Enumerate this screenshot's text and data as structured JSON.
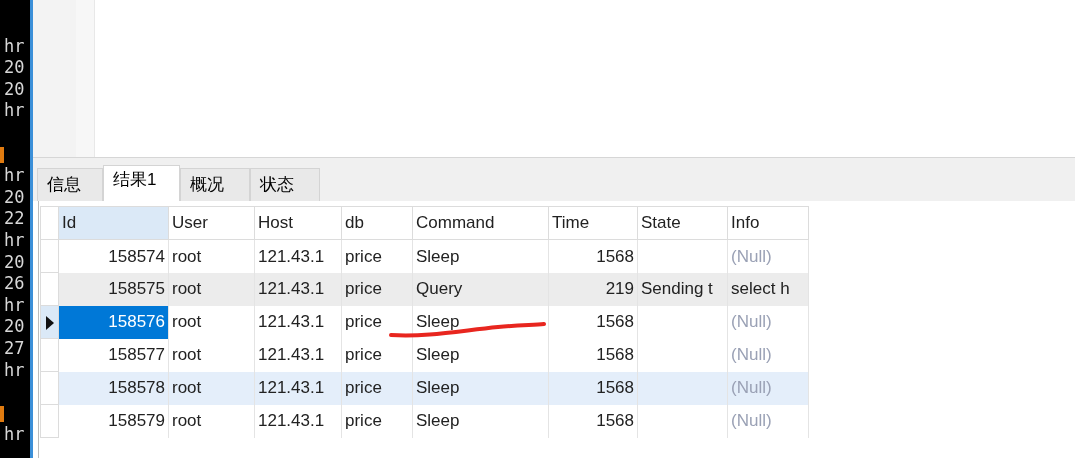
{
  "terminal": {
    "lines": [
      {
        "kind": "blank"
      },
      {
        "kind": "text",
        "text": "hr"
      },
      {
        "kind": "text",
        "text": "20"
      },
      {
        "kind": "text",
        "text": "20"
      },
      {
        "kind": "text",
        "text": "hr"
      },
      {
        "kind": "blank"
      },
      {
        "kind": "cursor"
      },
      {
        "kind": "text",
        "text": "hr"
      },
      {
        "kind": "text",
        "text": "20"
      },
      {
        "kind": "text",
        "text": "22"
      },
      {
        "kind": "text",
        "text": "hr"
      },
      {
        "kind": "text",
        "text": "20"
      },
      {
        "kind": "text",
        "text": "26"
      },
      {
        "kind": "text",
        "text": "hr"
      },
      {
        "kind": "text",
        "text": "20"
      },
      {
        "kind": "text",
        "text": "27"
      },
      {
        "kind": "text",
        "text": "hr"
      },
      {
        "kind": "blank"
      },
      {
        "kind": "cursor"
      },
      {
        "kind": "text",
        "text": "hr"
      }
    ]
  },
  "tabs": [
    {
      "label": "信息",
      "selected": false
    },
    {
      "label": "结果1",
      "selected": true
    },
    {
      "label": "概况",
      "selected": false
    },
    {
      "label": "状态",
      "selected": false
    }
  ],
  "table": {
    "columns": [
      {
        "label": "Id",
        "kind": "number",
        "selected": true
      },
      {
        "label": "User",
        "kind": "text",
        "selected": false
      },
      {
        "label": "Host",
        "kind": "text",
        "selected": false
      },
      {
        "label": "db",
        "kind": "text",
        "selected": false
      },
      {
        "label": "Command",
        "kind": "text",
        "selected": false
      },
      {
        "label": "Time",
        "kind": "number",
        "selected": false
      },
      {
        "label": "State",
        "kind": "text",
        "selected": false
      },
      {
        "label": "Info",
        "kind": "text",
        "selected": false
      }
    ],
    "rows": [
      {
        "selected": false,
        "shaded": false,
        "hovered": false,
        "cells": [
          "158574",
          "root",
          "121.43.1",
          "price",
          "Sleep",
          "1568",
          "",
          "(Null)"
        ],
        "info_null": true
      },
      {
        "selected": false,
        "shaded": true,
        "hovered": false,
        "cells": [
          "158575",
          "root",
          "121.43.1",
          "price",
          "Query",
          "219",
          "Sending t",
          "select h"
        ],
        "info_null": false
      },
      {
        "selected": true,
        "shaded": false,
        "hovered": false,
        "cells": [
          "158576",
          "root",
          "121.43.1",
          "price",
          "Sleep",
          "1568",
          "",
          "(Null)"
        ],
        "info_null": true
      },
      {
        "selected": false,
        "shaded": false,
        "hovered": false,
        "cells": [
          "158577",
          "root",
          "121.43.1",
          "price",
          "Sleep",
          "1568",
          "",
          "(Null)"
        ],
        "info_null": true
      },
      {
        "selected": false,
        "shaded": false,
        "hovered": true,
        "cells": [
          "158578",
          "root",
          "121.43.1",
          "price",
          "Sleep",
          "1568",
          "",
          "(Null)"
        ],
        "info_null": true
      },
      {
        "selected": false,
        "shaded": false,
        "hovered": false,
        "cells": [
          "158579",
          "root",
          "121.43.1",
          "price",
          "Sleep",
          "1568",
          "",
          "(Null)"
        ],
        "info_null": true
      }
    ]
  }
}
